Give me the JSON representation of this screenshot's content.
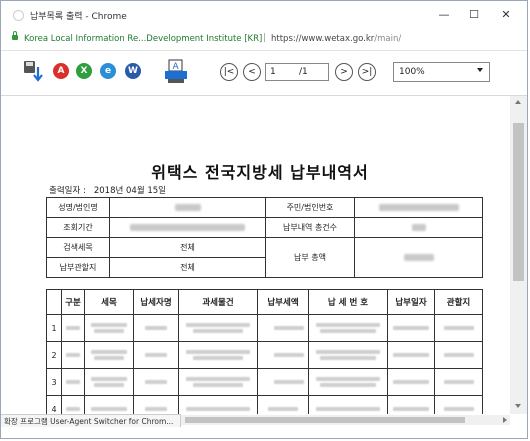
{
  "window": {
    "title": "납부목록 출력 - Chrome",
    "controls": {
      "minimize": "—",
      "maximize": "☐",
      "close": "✕"
    }
  },
  "address_bar": {
    "site_identity": "Korea Local Information Re...Development Institute [KR]",
    "separator": "|",
    "url_host": "https://www.wetax.go.kr",
    "url_path": "/main/"
  },
  "toolbar": {
    "icons": [
      "save-download-icon",
      "pdf-icon",
      "excel-icon",
      "hwp-icon",
      "word-icon",
      "print-icon"
    ],
    "icon_letters": {
      "pdf": "A",
      "excel": "X",
      "hwp": "e",
      "word": "W",
      "print": "A"
    },
    "nav": {
      "first": "|<",
      "prev": "<",
      "next": ">",
      "last": ">|"
    },
    "page_current": "1",
    "page_total": "/1",
    "zoom": "100%",
    "colors": {
      "pdf": "#d9302b",
      "excel": "#2f9e3f",
      "hwp": "#2a8fd6",
      "word": "#2a5aa8"
    }
  },
  "document": {
    "title": "위택스 전국지방세 납부내역서",
    "print_date_label": "출력일자 :",
    "print_date_value": "2018년 04월 15일",
    "info": {
      "name_label": "성명/법인명",
      "resident_no_label": "주민/법인번호",
      "period_label": "조회기간",
      "payment_count_label": "납부내역 총건수",
      "tax_item_label": "검색세목",
      "tax_item_value": "전체",
      "payment_total_label": "납부 총액",
      "jurisdiction_label": "납부관할지",
      "jurisdiction_value": "전체"
    },
    "list_headers": [
      "구분",
      "세목",
      "납세자명",
      "과세물건",
      "납부세액",
      "납 세 번 호",
      "납부일자",
      "관할지"
    ],
    "row_numbers": [
      "1",
      "2",
      "3",
      "4"
    ]
  },
  "status_bar": {
    "text": "확장 프로그램 User-Agent Switcher for Chrom..."
  }
}
